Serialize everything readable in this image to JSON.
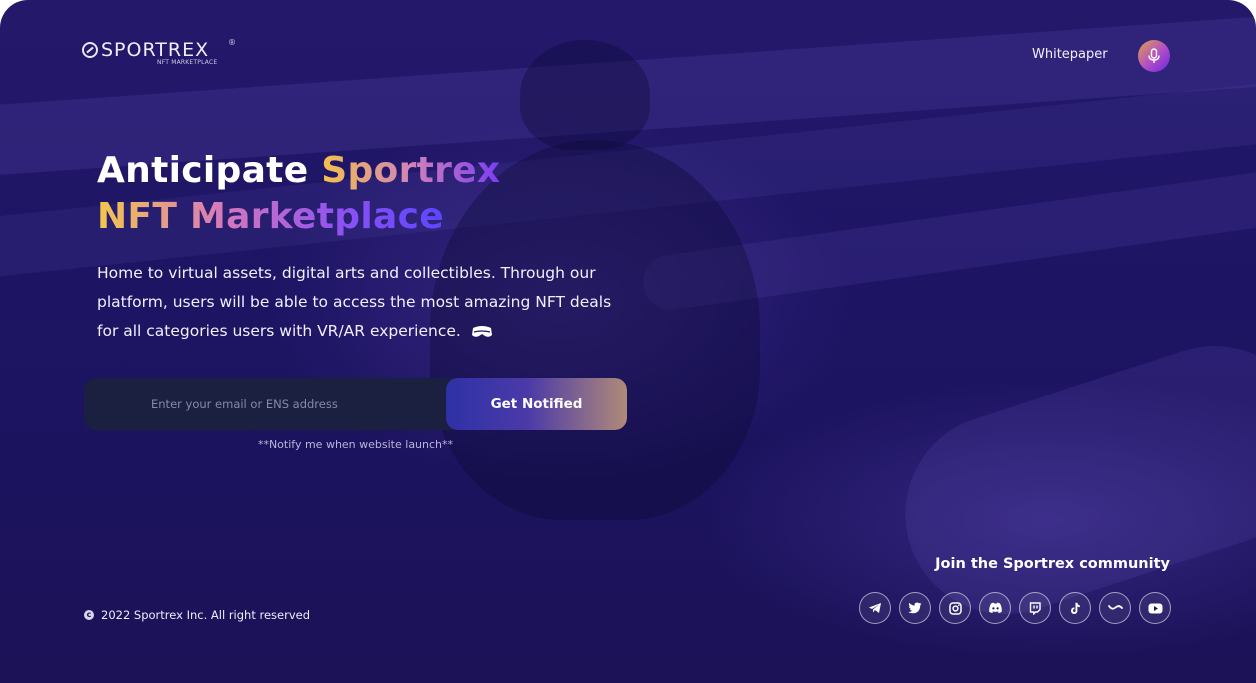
{
  "brand": {
    "name": "SPORTREX",
    "tagline": "NFT MARKETPLACE",
    "registered": "®"
  },
  "nav": {
    "whitepaper": "Whitepaper",
    "mic_icon": "microphone-icon"
  },
  "hero": {
    "line1_white": "Anticipate ",
    "line1_gradient": "Sportrex",
    "line2_gradient": "NFT Marketplace",
    "description": "Home to virtual assets, digital arts and collectibles. Through our platform, users will be able to access the most amazing NFT deals for all categories users with VR/AR experience.",
    "description_icon": "vr-headset-icon"
  },
  "signup": {
    "placeholder": "Enter your email or ENS address",
    "button": "Get Notified",
    "hint": "**Notify me when website launch**"
  },
  "footer": {
    "copyright_symbol": "c",
    "copyright": "2022 Sportrex Inc. All right reserved",
    "community_title": "Join the Sportrex community",
    "socials": [
      {
        "icon": "telegram-icon"
      },
      {
        "icon": "twitter-icon"
      },
      {
        "icon": "instagram-icon"
      },
      {
        "icon": "discord-icon"
      },
      {
        "icon": "twitch-icon"
      },
      {
        "icon": "tiktok-icon"
      },
      {
        "icon": "wave-icon"
      },
      {
        "icon": "youtube-icon"
      }
    ]
  },
  "colors": {
    "background": "#1d1463",
    "gold": "#f5c24a",
    "purple": "#7c3cf2",
    "input_bg": "#1b2040"
  }
}
